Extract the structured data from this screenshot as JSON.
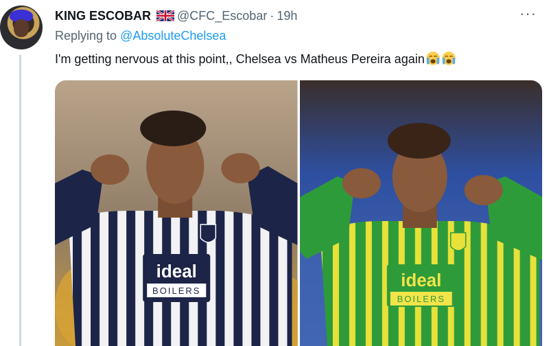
{
  "tweet": {
    "display_name": "KING ESCOBAR",
    "apple_emoji": "",
    "handle": "@CFC_Escobar",
    "separator": "·",
    "time": "19h",
    "more_label": "···",
    "replying_prefix": "Replying to",
    "replying_to": "@AbsoluteChelsea",
    "text": "I'm getting nervous at this point,, Chelsea vs Matheus Pereira again"
  },
  "media": {
    "left": {
      "shirt_text_top": "ideal",
      "shirt_text_bottom": "BOILERS"
    },
    "right": {
      "shirt_text_top": "ideal",
      "shirt_text_bottom": "BOILERS"
    }
  },
  "colors": {
    "link": "#1d9bf0",
    "secondary_text": "#536471",
    "thread_line": "#cfd9de",
    "home_kit_navy": "#1c2447",
    "away_kit_green": "#2e9b3a",
    "away_kit_yellow": "#e7e13a"
  }
}
